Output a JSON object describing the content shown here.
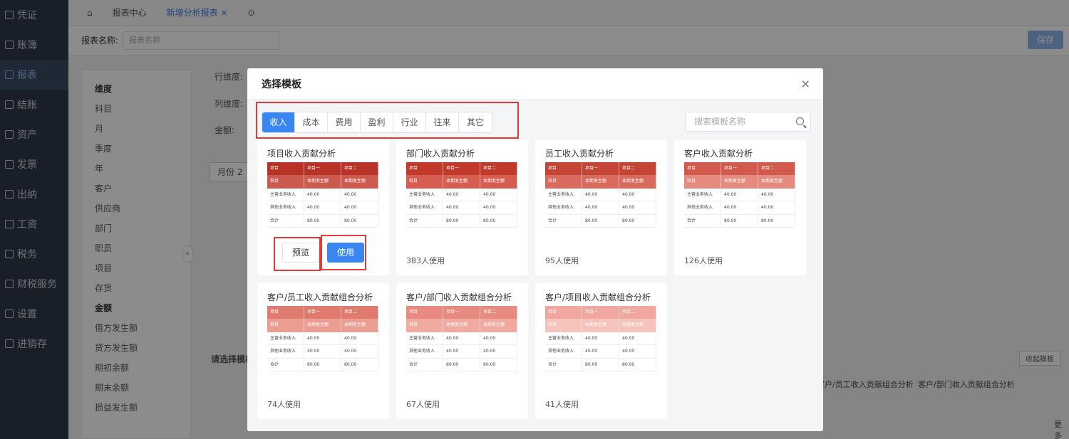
{
  "sidebar": {
    "items": [
      {
        "label": "凭证"
      },
      {
        "label": "账簿"
      },
      {
        "label": "报表"
      },
      {
        "label": "结账"
      },
      {
        "label": "资产"
      },
      {
        "label": "发票"
      },
      {
        "label": "出纳"
      },
      {
        "label": "工资"
      },
      {
        "label": "税务"
      },
      {
        "label": "财税服务"
      },
      {
        "label": "设置"
      },
      {
        "label": "进销存"
      }
    ],
    "active_index": 2
  },
  "tabs": {
    "home": "⌂",
    "report_center": "报表中心",
    "new_report": "新增分析报表",
    "close": "×",
    "more": "⊙"
  },
  "toolbar": {
    "name_label": "报表名称:",
    "name_placeholder": "报表名称",
    "save": "保存"
  },
  "dims_panel": {
    "items": [
      "维度",
      "科目",
      "月",
      "季度",
      "年",
      "客户",
      "供应商",
      "部门",
      "职员",
      "项目",
      "存货",
      "金额",
      "借方发生额",
      "贷方发生额",
      "期初余额",
      "期末余额",
      "损益发生额"
    ]
  },
  "back_labels": {
    "row_dim": "行维度:",
    "col_dim": "列维度:",
    "amount": "金额:",
    "month": "月份",
    "month_val": "2",
    "choose_template": "请选择模板",
    "collapse_template": "收起模板",
    "more": "更多"
  },
  "modal": {
    "title": "选择模板",
    "close": "×",
    "categories": [
      "收入",
      "成本",
      "费用",
      "盈利",
      "行业",
      "往来",
      "其它"
    ],
    "active_category": 0,
    "search_placeholder": "搜索模板名称",
    "preview_button": "预览",
    "use_button": "使用",
    "templates": [
      {
        "title": "项目收入贡献分析",
        "usage": ""
      },
      {
        "title": "部门收入贡献分析",
        "usage": "383人使用"
      },
      {
        "title": "员工收入贡献分析",
        "usage": "95人使用"
      },
      {
        "title": "客户收入贡献分析",
        "usage": "126人使用"
      },
      {
        "title": "客户/员工收入贡献组合分析",
        "usage": "74人使用"
      },
      {
        "title": "客户/部门收入贡献组合分析",
        "usage": "67人使用"
      },
      {
        "title": "客户/项目收入贡献组合分析",
        "usage": "41人使用"
      }
    ]
  },
  "thumb_rows": {
    "head1": [
      "项目",
      "项目一",
      "项目二"
    ],
    "head2": [
      "科目",
      "本期发生额",
      "本期发生额"
    ],
    "row1": [
      "主营业务收入",
      "40.00",
      "40.00"
    ],
    "row2": [
      "其他业务收入",
      "40.00",
      "40.00"
    ],
    "total": [
      "合计",
      "80.00",
      "80.00"
    ]
  },
  "background_cards": [
    "客户/员工收入贡献组合分析",
    "客户/部门收入贡献组合分析"
  ],
  "colors": {
    "accent": "#3a86f0",
    "header_dark": "#c0392b",
    "header_mid": "#e07468",
    "highlight_box": "#e53935"
  }
}
